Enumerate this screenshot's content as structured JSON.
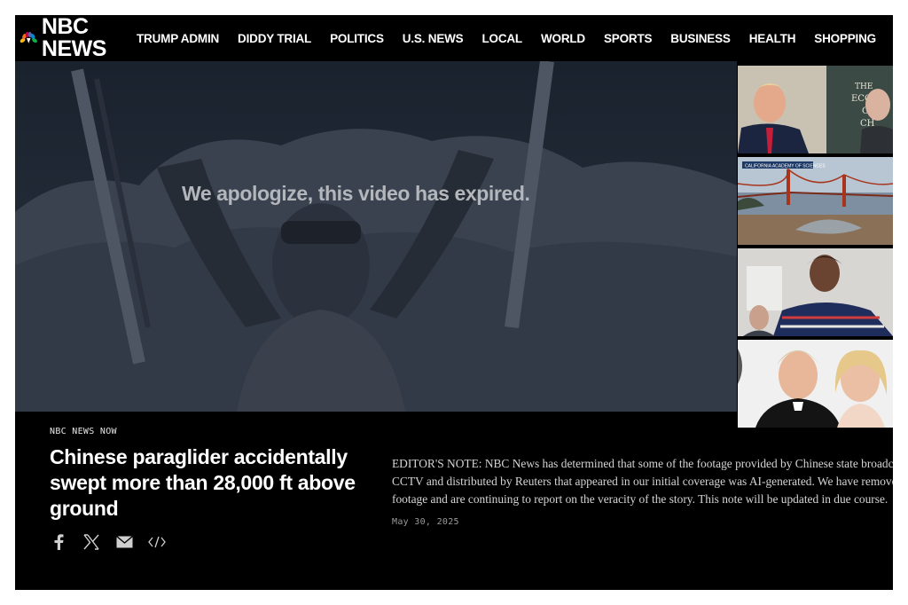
{
  "header": {
    "logo_text": "NBC NEWS",
    "nav": [
      "TRUMP ADMIN",
      "DIDDY TRIAL",
      "POLITICS",
      "U.S. NEWS",
      "LOCAL",
      "WORLD",
      "SPORTS",
      "BUSINESS",
      "HEALTH",
      "SHOPPING"
    ]
  },
  "video": {
    "expired_message": "We apologize, this video has expired."
  },
  "thumbnails": {
    "thumb1_sign": "THE ECO C CH",
    "thumb2_banner": "CALIFORNIA ACADEMY OF SCIENCES"
  },
  "story": {
    "eyebrow": "NBC NEWS NOW",
    "headline": "Chinese paraglider accidentally swept more than 28,000 ft above ground",
    "editors_note": "EDITOR'S NOTE: NBC News has determined that some of the footage provided by Chinese state broadcaster CCTV and distributed by Reuters that appeared in our initial coverage was AI-generated. We have removed that footage and are continuing to report on the veracity of the story. This note will be updated in due course.",
    "date": "May 30, 2025"
  },
  "share_icons": [
    "facebook-icon",
    "x-icon",
    "email-icon",
    "embed-icon"
  ],
  "colors": {
    "background": "#000000",
    "text": "#ffffff",
    "overlay_text": "#b3b6bb"
  }
}
